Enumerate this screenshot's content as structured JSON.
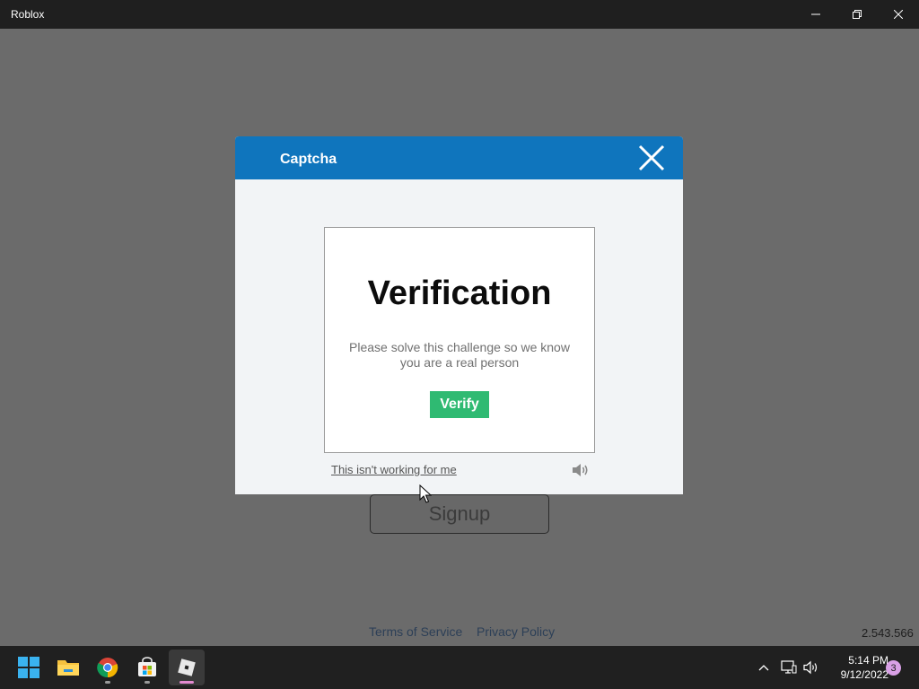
{
  "window": {
    "title": "Roblox",
    "controls": [
      "minimize-icon",
      "restore-icon",
      "close-icon"
    ]
  },
  "background_app": {
    "signup_label": "Signup",
    "terms_label": "Terms of Service",
    "privacy_label": "Privacy Policy",
    "version": "2.543.566"
  },
  "captcha": {
    "title": "Captcha",
    "heading": "Verification",
    "description": "Please solve this challenge so we know you are a real person",
    "verify_label": "Verify",
    "not_working_label": "This isn't working for me",
    "audio_icon": "speaker-icon",
    "colors": {
      "header": "#0f75bd",
      "verify": "#2fba72"
    }
  },
  "taskbar": {
    "apps": [
      {
        "icon": "windows-start-icon"
      },
      {
        "icon": "file-explorer-icon"
      },
      {
        "icon": "chrome-icon"
      },
      {
        "icon": "microsoft-store-icon"
      },
      {
        "icon": "roblox-icon",
        "active": true
      }
    ],
    "tray": {
      "time": "5:14 PM",
      "date": "9/12/2022",
      "notifications": "3"
    }
  }
}
